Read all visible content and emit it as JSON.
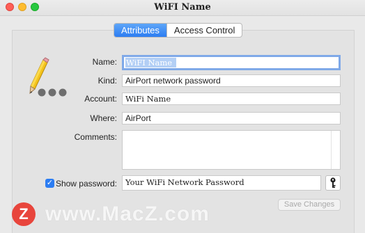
{
  "window": {
    "title": "WiFI Name",
    "traffic_lights": [
      "close",
      "minimize",
      "zoom"
    ]
  },
  "tabs": [
    {
      "label": "Attributes",
      "active": true
    },
    {
      "label": "Access Control",
      "active": false
    }
  ],
  "form": {
    "name_label": "Name:",
    "name_value": "WiFI Name",
    "kind_label": "Kind:",
    "kind_value": "AirPort network password",
    "account_label": "Account:",
    "account_value": "WiFi Name",
    "where_label": "Where:",
    "where_value": "AirPort",
    "comments_label": "Comments:",
    "comments_value": "",
    "show_password_label": "Show password:",
    "show_password_checked": true,
    "password_value": "Your WiFi Network Password",
    "save_label": "Save Changes"
  },
  "icons": {
    "item_icon": "pencil-with-dots-icon",
    "key_icon": "key-icon"
  },
  "watermark": {
    "logo_letter": "Z",
    "text": "www.MacZ.com"
  },
  "colors": {
    "accent": "#2c7df2",
    "selection": "#b3cff5",
    "watermark_logo": "#e8453c"
  }
}
